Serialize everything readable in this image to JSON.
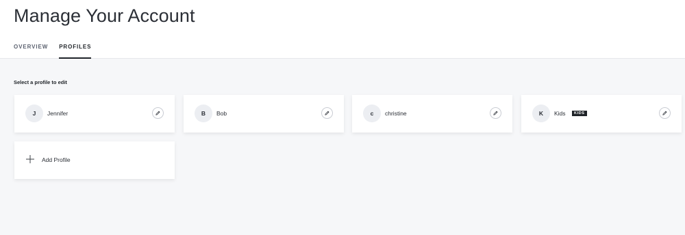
{
  "header": {
    "title": "Manage Your Account",
    "tabs": [
      {
        "label": "OVERVIEW",
        "active": false
      },
      {
        "label": "PROFILES",
        "active": true
      }
    ]
  },
  "profiles_section": {
    "label": "Select a profile to edit",
    "profiles": [
      {
        "initial": "J",
        "name": "Jennifer",
        "badge": ""
      },
      {
        "initial": "B",
        "name": "Bob",
        "badge": ""
      },
      {
        "initial": "c",
        "name": "christine",
        "badge": ""
      },
      {
        "initial": "K",
        "name": "Kids",
        "badge": "KIDS"
      }
    ],
    "add_label": "Add Profile"
  },
  "icons": {
    "edit": "pencil-icon",
    "add": "plus-icon"
  },
  "colors": {
    "background": "#f6f7f9",
    "card": "#ffffff",
    "text": "#1f2328",
    "badge": "#1f2328"
  }
}
